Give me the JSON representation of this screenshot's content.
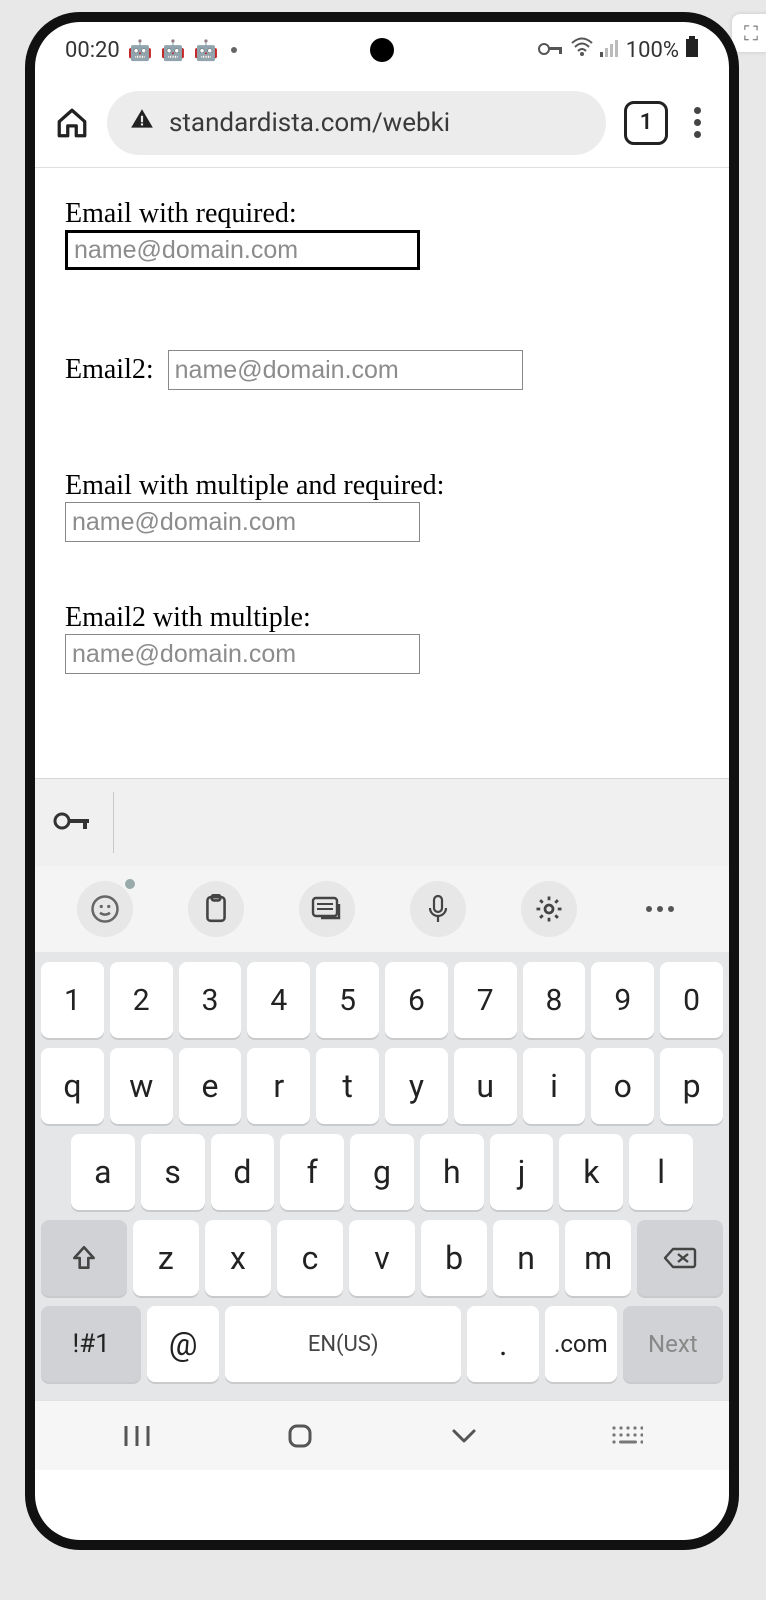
{
  "status": {
    "time": "00:20",
    "battery": "100%"
  },
  "browser": {
    "url": "standardista.com/webki",
    "tab_count": "1"
  },
  "form": {
    "fields": [
      {
        "label": "Email with required:",
        "placeholder": "name@domain.com"
      },
      {
        "label": "Email2:",
        "placeholder": "name@domain.com"
      },
      {
        "label": "Email with multiple and required:",
        "placeholder": "name@domain.com"
      },
      {
        "label": "Email2 with multiple:",
        "placeholder": "name@domain.com"
      }
    ]
  },
  "keyboard": {
    "rows": {
      "nums": [
        "1",
        "2",
        "3",
        "4",
        "5",
        "6",
        "7",
        "8",
        "9",
        "0"
      ],
      "r1": [
        "q",
        "w",
        "e",
        "r",
        "t",
        "y",
        "u",
        "i",
        "o",
        "p"
      ],
      "r2": [
        "a",
        "s",
        "d",
        "f",
        "g",
        "h",
        "j",
        "k",
        "l"
      ],
      "r3": [
        "z",
        "x",
        "c",
        "v",
        "b",
        "n",
        "m"
      ]
    },
    "sym": "!#1",
    "at": "@",
    "space": "EN(US)",
    "period": ".",
    "dotcom": ".com",
    "next": "Next"
  }
}
